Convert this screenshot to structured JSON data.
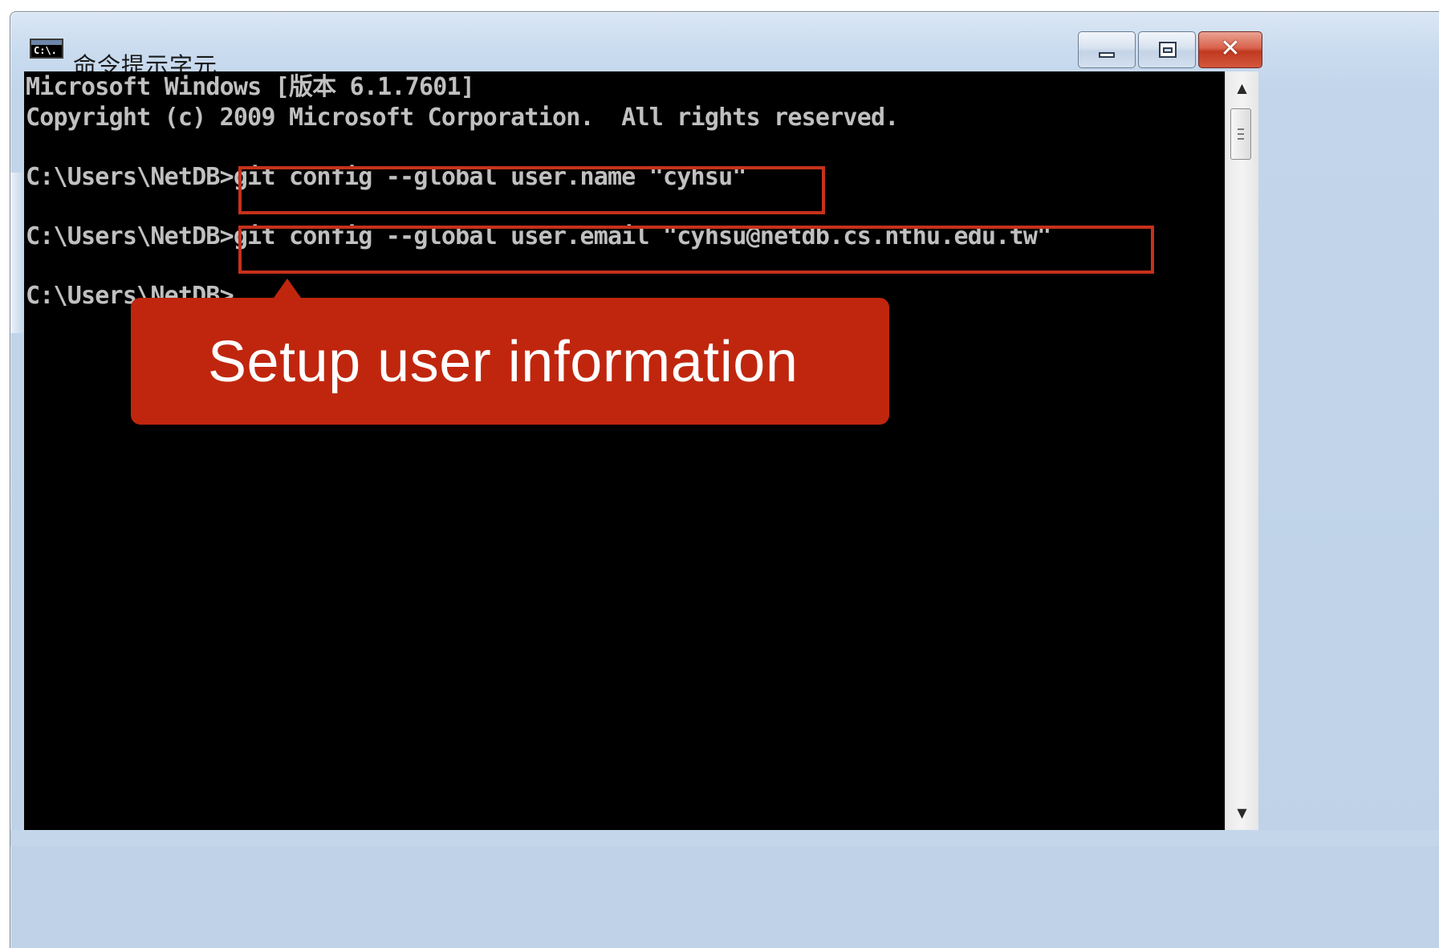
{
  "window": {
    "title": "命令提示字元",
    "icon": "cmd-icon",
    "icon_text": "C:\\.",
    "buttons": {
      "minimize": "minimize-icon",
      "maximize": "maximize-icon",
      "close": "close-icon",
      "close_glyph": "✕"
    }
  },
  "console": {
    "lines": [
      "Microsoft Windows [版本 6.1.7601]",
      "Copyright (c) 2009 Microsoft Corporation.  All rights reserved.",
      "",
      "C:\\Users\\NetDB>git config --global user.name \"cyhsu\"",
      "",
      "C:\\Users\\NetDB>git config --global user.email \"cyhsu@netdb.cs.nthu.edu.tw\"",
      "",
      "C:\\Users\\NetDB>"
    ],
    "text_color": "#c0c0c0",
    "background": "#000000"
  },
  "callout": {
    "text": "Setup user information",
    "color": "#c0260e"
  },
  "highlight_color": "#c6311c",
  "scrollbar": {
    "up_arrow": "▲",
    "down_arrow": "▼"
  }
}
